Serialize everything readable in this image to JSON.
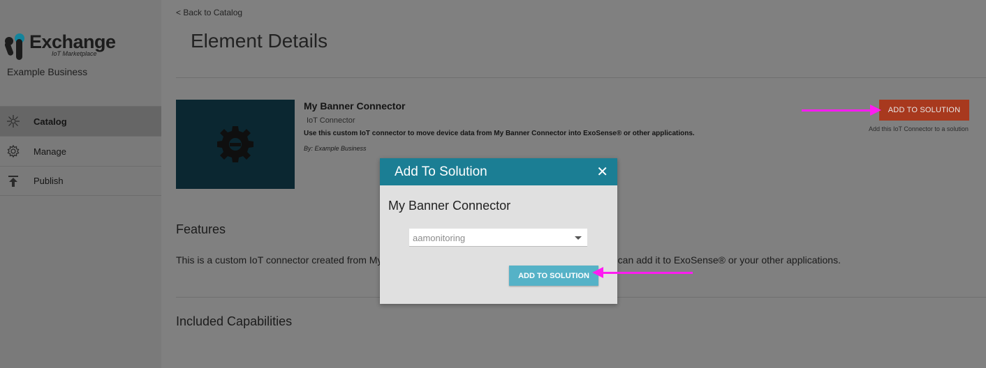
{
  "sidebar": {
    "logo_title": "Exchange",
    "logo_subtitle": "IoT Marketplace",
    "business": "Example Business",
    "items": [
      {
        "label": "Catalog",
        "icon": "catalog-icon",
        "active": true
      },
      {
        "label": "Manage",
        "icon": "gear-icon",
        "active": false
      },
      {
        "label": "Publish",
        "icon": "upload-icon",
        "active": false
      }
    ]
  },
  "main": {
    "back_link": "< Back to Catalog",
    "page_title": "Element Details",
    "element": {
      "name": "My Banner Connector",
      "type": "IoT Connector",
      "description": "Use this custom IoT connector to move device data from My Banner Connector into ExoSense® or other applications.",
      "by": "By: Example Business",
      "thumbnail_icon": "connector-gear-icon"
    },
    "add_button": "ADD TO SOLUTION",
    "add_hint": "Add this IoT Connector to a solution",
    "features_heading": "Features",
    "features_text_left": "This is a custom IoT connector created from My",
    "features_text_right": "u can add it to ExoSense® or your other applications.",
    "capabilities_heading": "Included Capabilities"
  },
  "modal": {
    "title": "Add To Solution",
    "close": "✕",
    "element_name": "My Banner Connector",
    "select_value": "aamonitoring",
    "submit_label": "ADD TO SOLUTION"
  },
  "colors": {
    "accent_red": "#a8391e",
    "modal_header": "#1b7e94",
    "modal_button": "#55b2c7",
    "annotation_arrow": "#ff1cf2"
  }
}
